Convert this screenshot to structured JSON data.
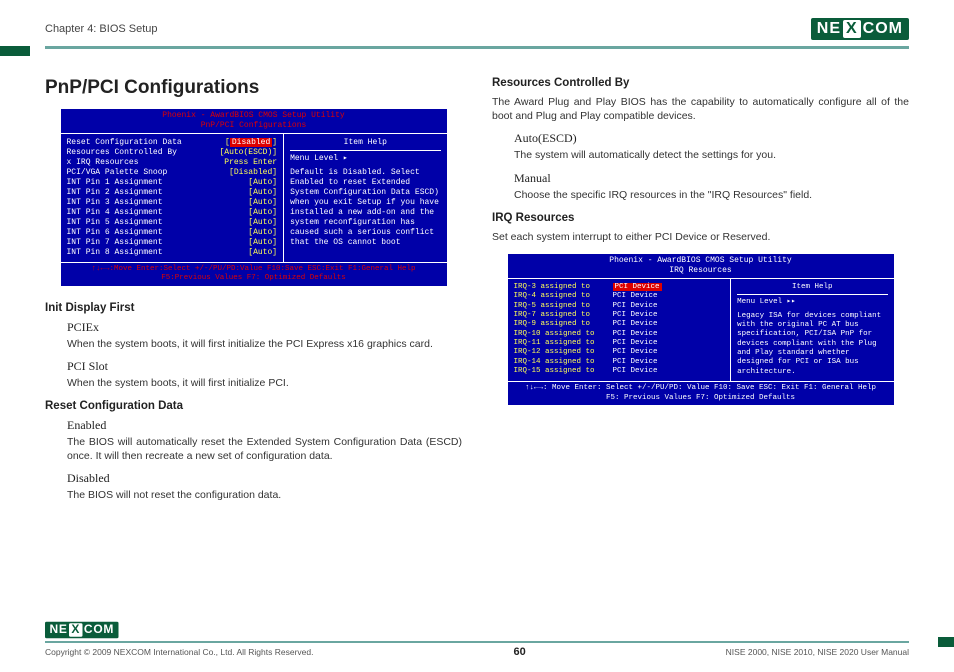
{
  "header": {
    "chapter": "Chapter 4: BIOS Setup",
    "brand_left": "NE",
    "brand_x": "X",
    "brand_right": "COM"
  },
  "left": {
    "title": "PnP/PCI Configurations",
    "bios1": {
      "title1": "Phoenix - AwardBIOS CMOS Setup Utility",
      "title2": "PnP/PCI Configurations",
      "rows": [
        {
          "label": "Reset Configuration Data",
          "val": "[Disabled]"
        },
        {
          "label": "",
          "val": ""
        },
        {
          "label": "Resources Controlled By",
          "val": "[Auto(ESCD)]"
        },
        {
          "label": "x IRQ Resources",
          "val": "Press Enter"
        },
        {
          "label": "",
          "val": ""
        },
        {
          "label": "PCI/VGA Palette Snoop",
          "val": "[Disabled]"
        },
        {
          "label": "INT Pin 1 Assignment",
          "val": "[Auto]"
        },
        {
          "label": "INT Pin 2 Assignment",
          "val": "[Auto]"
        },
        {
          "label": "INT Pin 3 Assignment",
          "val": "[Auto]"
        },
        {
          "label": "INT Pin 4 Assignment",
          "val": "[Auto]"
        },
        {
          "label": "INT Pin 5 Assignment",
          "val": "[Auto]"
        },
        {
          "label": "INT Pin 6 Assignment",
          "val": "[Auto]"
        },
        {
          "label": "INT Pin 7 Assignment",
          "val": "[Auto]"
        },
        {
          "label": "INT Pin 8 Assignment",
          "val": "[Auto]"
        }
      ],
      "help_title": "Item Help",
      "help_level": "Menu Level   ▸",
      "help_body": "Default is Disabled. Select Enabled to reset Extended System Configuration Data ESCD) when you exit Setup if you have installed a new add-on and the system reconfiguration has caused such a serious conflict that the OS cannot boot",
      "footer1": "↑↓←→:Move  Enter:Select  +/-/PU/PD:Value  F10:Save  ESC:Exit  F1:General Help",
      "footer2": "F5:Previous Values          F7: Optimized Defaults"
    },
    "h_init": "Init Display First",
    "t_pciex": "PCIEx",
    "d_pciex": "When the system boots, it will first initialize the PCI Express x16 graphics card.",
    "t_pcislot": "PCI Slot",
    "d_pcislot": "When the system boots, it will first initialize PCI.",
    "h_reset": "Reset Configuration Data",
    "t_enabled": "Enabled",
    "d_enabled": "The BIOS will automatically reset the Extended System Configuration Data (ESCD) once. It will then recreate a new set of configuration data.",
    "t_disabled": "Disabled",
    "d_disabled": "The BIOS will not reset the configuration data."
  },
  "right": {
    "h_rcb": "Resources Controlled By",
    "d_rcb": "The Award Plug and Play BIOS has the capability to automatically configure all of the boot and Plug and Play compatible devices.",
    "t_auto": "Auto(ESCD)",
    "d_auto": "The system will automatically detect the settings for you.",
    "t_manual": "Manual",
    "d_manual": "Choose the specific IRQ resources in the \"IRQ Resources\" field.",
    "h_irq": "IRQ Resources",
    "d_irq": "Set each system interrupt to either PCI Device or Reserved.",
    "bios2": {
      "title1": "Phoenix - AwardBIOS CMOS Setup Utility",
      "title2": "IRQ Resources",
      "irq_labels": [
        "IRQ-3   assigned to",
        "IRQ-4   assigned to",
        "IRQ-5   assigned to",
        "IRQ-7   assigned to",
        "IRQ-9   assigned to",
        "IRQ-10  assigned to",
        "IRQ-11  assigned to",
        "IRQ-12  assigned to",
        "IRQ-14  assigned to",
        "IRQ-15  assigned to"
      ],
      "irq_vals": [
        "PCI Device",
        "PCI Device",
        "PCI Device",
        "PCI Device",
        "PCI Device",
        "PCI Device",
        "PCI Device",
        "PCI Device",
        "PCI Device",
        "PCI Device"
      ],
      "help_title": "Item Help",
      "help_level": "Menu Level   ▸▸",
      "help_body": "Legacy ISA for devices compliant with the original PC AT bus specification, PCI/ISA PnP for devices compliant with the Plug and Play standard whether designed for PCI or ISA bus architecture.",
      "footer1": "↑↓←→: Move     Enter: Select     +/-/PU/PD: Value     F10: Save     ESC: Exit     F1: General Help",
      "footer2": "F5: Previous Values               F7: Optimized Defaults"
    }
  },
  "footer": {
    "copyright": "Copyright © 2009 NEXCOM International Co., Ltd. All Rights Reserved.",
    "page": "60",
    "manual": "NISE 2000, NISE 2010, NISE 2020 User Manual"
  }
}
